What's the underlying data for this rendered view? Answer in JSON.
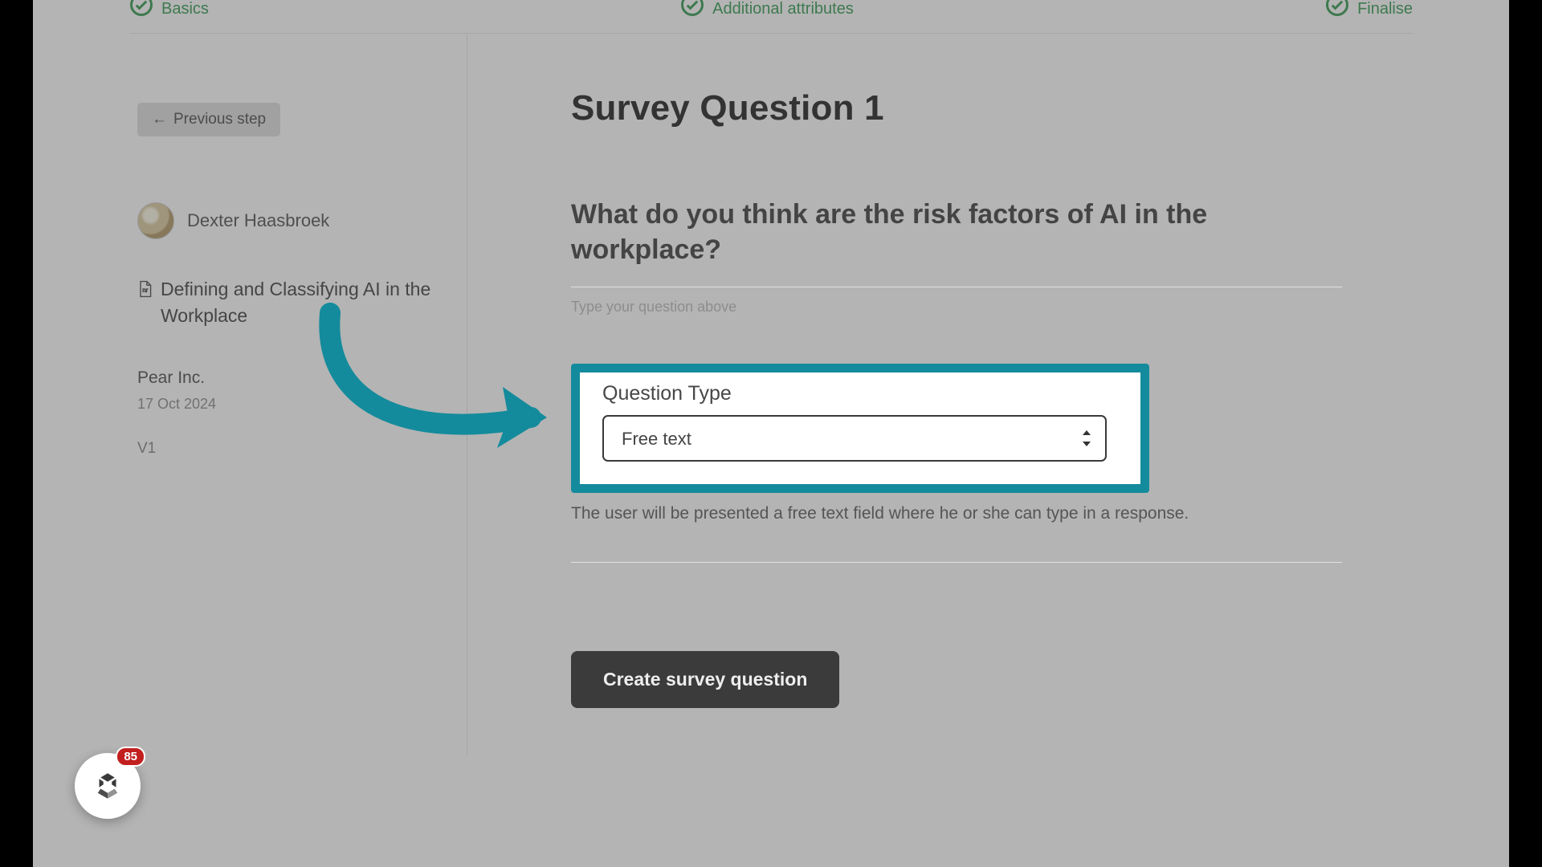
{
  "stepper": {
    "step1": "Basics",
    "step2": "Additional attributes",
    "step3": "Finalise"
  },
  "sidebar": {
    "prev_label": "Previous step",
    "user_name": "Dexter Haasbroek",
    "doc_title": "Defining and Classifying AI in the Workplace",
    "company": "Pear Inc.",
    "date": "17 Oct 2024",
    "version": "V1"
  },
  "main": {
    "title": "Survey Question 1",
    "question_text": "What do you think are the risk factors of AI in the workplace?",
    "hint": "Type your question above",
    "qtype_label": "Question Type",
    "qtype_value": "Free text",
    "qtype_desc": "The user will be presented a free text field where he or she can type in a response.",
    "create_label": "Create survey question"
  },
  "widget": {
    "badge": "85"
  },
  "colors": {
    "accent_green": "#3f9c5a",
    "highlight_teal": "#148b9c",
    "badge_red": "#c21f1f"
  }
}
